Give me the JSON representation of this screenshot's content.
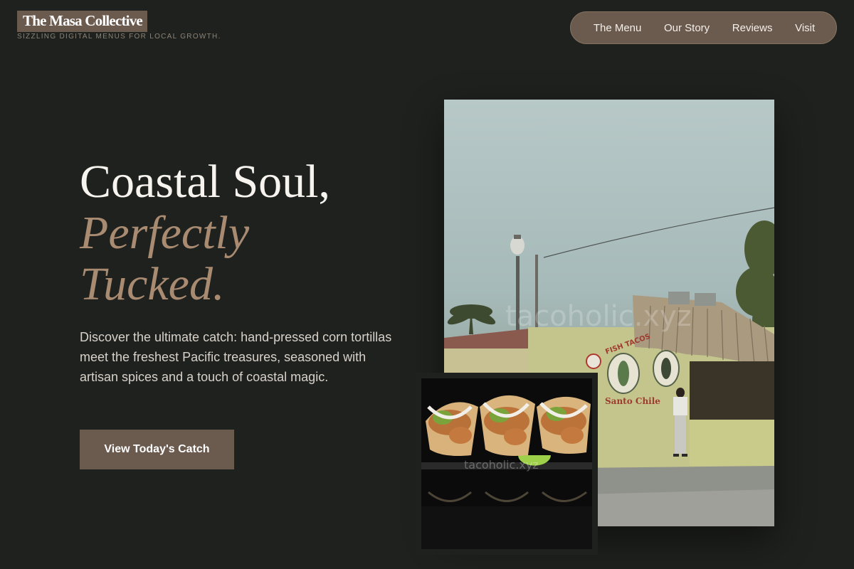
{
  "brand": {
    "name": "The Masa Collective",
    "tagline": "Sizzling digital menus for local growth."
  },
  "nav": {
    "items": [
      {
        "label": "The Menu"
      },
      {
        "label": "Our Story"
      },
      {
        "label": "Reviews"
      },
      {
        "label": "Visit"
      }
    ]
  },
  "hero": {
    "title_line1": "Coastal Soul,",
    "title_line2": "Perfectly",
    "title_line3": "Tucked.",
    "description": "Discover the ultimate catch: hand-pressed corn tortillas meet the freshest Pacific treasures, seasoned with artisan spices and a touch of coastal magic.",
    "cta_label": "View Today's Catch"
  },
  "photos": {
    "restaurant": {
      "watermark": "tacoholic.xyz",
      "sign_text": "Fish Tacos",
      "sign_subtext": "Santo Chile"
    },
    "tacos": {
      "watermark": "tacoholic.xyz"
    }
  },
  "colors": {
    "background": "#1f211e",
    "accent": "#6b5a4e",
    "accent_text": "#a98b72"
  }
}
